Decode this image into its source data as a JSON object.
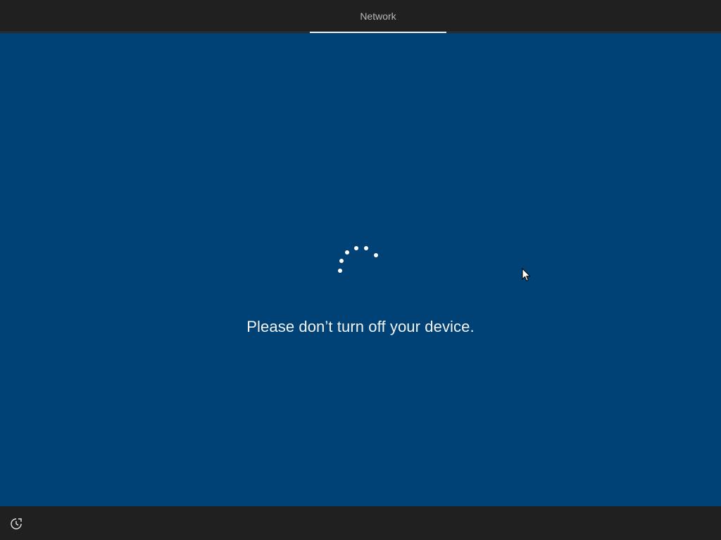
{
  "header": {
    "tab_label": "Network"
  },
  "main": {
    "message": "Please don’t turn off your device.",
    "background_color": "#004275",
    "spinner_icon": "loading-spinner-icon"
  },
  "footer": {
    "accessibility_icon": "ease-of-access-icon"
  },
  "colors": {
    "bar": "#202020",
    "text": "#f3f3f3",
    "tab_text": "#b8b8b8"
  }
}
